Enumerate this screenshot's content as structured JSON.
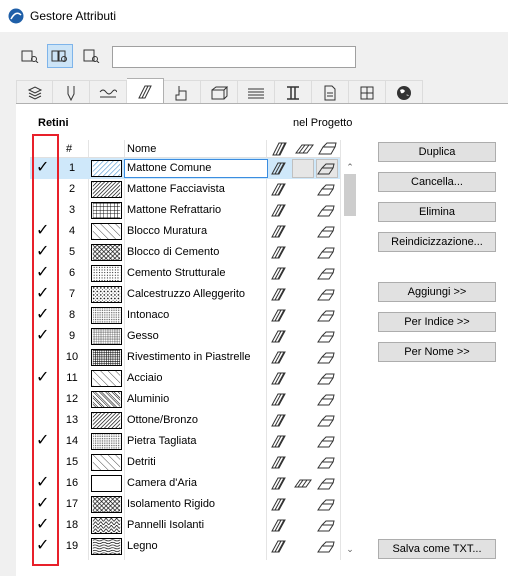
{
  "window": {
    "title": "Gestore Attributi"
  },
  "search": {
    "value": ""
  },
  "view_buttons": [
    "list-view-icon",
    "dual-view-icon",
    "detail-view-icon"
  ],
  "tabs": [
    "layers-icon",
    "pen-icon",
    "line-type-icon",
    "fill-icon",
    "composite-icon",
    "profile-icon",
    "zone-icon",
    "mep-icon",
    "material-icon",
    "surface-icon",
    "globe-icon"
  ],
  "section": {
    "title": "Retini",
    "in_project_label": "nel Progetto"
  },
  "table": {
    "col_num": "#",
    "col_name": "Nome",
    "rows": [
      {
        "num": "1",
        "name": "Mattone Comune",
        "checked": true,
        "pattern": "selected-hatch",
        "selected": true
      },
      {
        "num": "2",
        "name": "Mattone Facciavista",
        "checked": false,
        "pattern": "dense-diagonal"
      },
      {
        "num": "3",
        "name": "Mattone Refrattario",
        "checked": false,
        "pattern": "grid"
      },
      {
        "num": "4",
        "name": "Blocco Muratura",
        "checked": true,
        "pattern": "sparse-diagonal"
      },
      {
        "num": "5",
        "name": "Blocco di Cemento",
        "checked": true,
        "pattern": "crosshatch"
      },
      {
        "num": "6",
        "name": "Cemento Strutturale",
        "checked": true,
        "pattern": "dots"
      },
      {
        "num": "7",
        "name": "Calcestruzzo Alleggerito",
        "checked": true,
        "pattern": "dots-coarse"
      },
      {
        "num": "8",
        "name": "Intonaco",
        "checked": true,
        "pattern": "fine-dots"
      },
      {
        "num": "9",
        "name": "Gesso",
        "checked": true,
        "pattern": "fine-grid"
      },
      {
        "num": "10",
        "name": "Rivestimento in Piastrelle",
        "checked": false,
        "pattern": "dense-grid"
      },
      {
        "num": "11",
        "name": "Acciaio",
        "checked": true,
        "pattern": "sparse-diagonal"
      },
      {
        "num": "12",
        "name": "Aluminio",
        "checked": false,
        "pattern": "double-diagonal"
      },
      {
        "num": "13",
        "name": "Ottone/Bronzo",
        "checked": false,
        "pattern": "dense-diagonal"
      },
      {
        "num": "14",
        "name": "Pietra Tagliata",
        "checked": true,
        "pattern": "fine-dots"
      },
      {
        "num": "15",
        "name": "Detriti",
        "checked": false,
        "pattern": "sparse-diagonal"
      },
      {
        "num": "16",
        "name": "Camera d'Aria",
        "checked": true,
        "pattern": "empty"
      },
      {
        "num": "17",
        "name": "Isolamento Rigido",
        "checked": true,
        "pattern": "crosshatch"
      },
      {
        "num": "18",
        "name": "Pannelli Isolanti",
        "checked": true,
        "pattern": "zigzag"
      },
      {
        "num": "19",
        "name": "Legno",
        "checked": true,
        "pattern": "wood"
      }
    ]
  },
  "buttons": {
    "duplica": "Duplica",
    "cancella": "Cancella...",
    "elimina": "Elimina",
    "reindicizzazione": "Reindicizzazione...",
    "aggiungi": "Aggiungi >>",
    "per_indice": "Per Indice >>",
    "per_nome": "Per Nome >>",
    "salva_txt": "Salva come TXT..."
  },
  "colors": {
    "highlight": "#e8202a",
    "selection": "#cfe8fa",
    "accent": "#3b8de0"
  }
}
